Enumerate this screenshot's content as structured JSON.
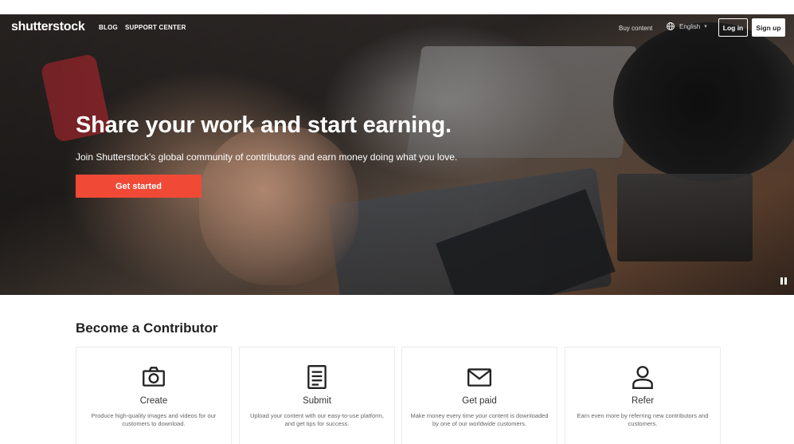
{
  "header": {
    "logo": "shutterstock",
    "links": [
      "BLOG",
      "SUPPORT CENTER"
    ],
    "buy_content": "Buy content",
    "language": "English",
    "login": "Log in",
    "signup": "Sign up"
  },
  "hero": {
    "title": "Share your work and start earning.",
    "subtitle": "Join Shutterstock's global community of contributors and earn money doing what you love.",
    "cta": "Get started"
  },
  "section": {
    "title": "Become a Contributor",
    "cards": [
      {
        "icon": "camera-icon",
        "title": "Create",
        "desc": "Produce high-quality images and videos for our customers to download."
      },
      {
        "icon": "document-icon",
        "title": "Submit",
        "desc": "Upload your content with our easy-to-use platform, and get tips for success."
      },
      {
        "icon": "envelope-icon",
        "title": "Get paid",
        "desc": "Make money every time your content is downloaded by one of our worldwide customers."
      },
      {
        "icon": "user-icon",
        "title": "Refer",
        "desc": "Earn even more by referring new contributors and customers."
      }
    ]
  },
  "colors": {
    "cta": "#f04a36",
    "text_dark": "#222222"
  }
}
